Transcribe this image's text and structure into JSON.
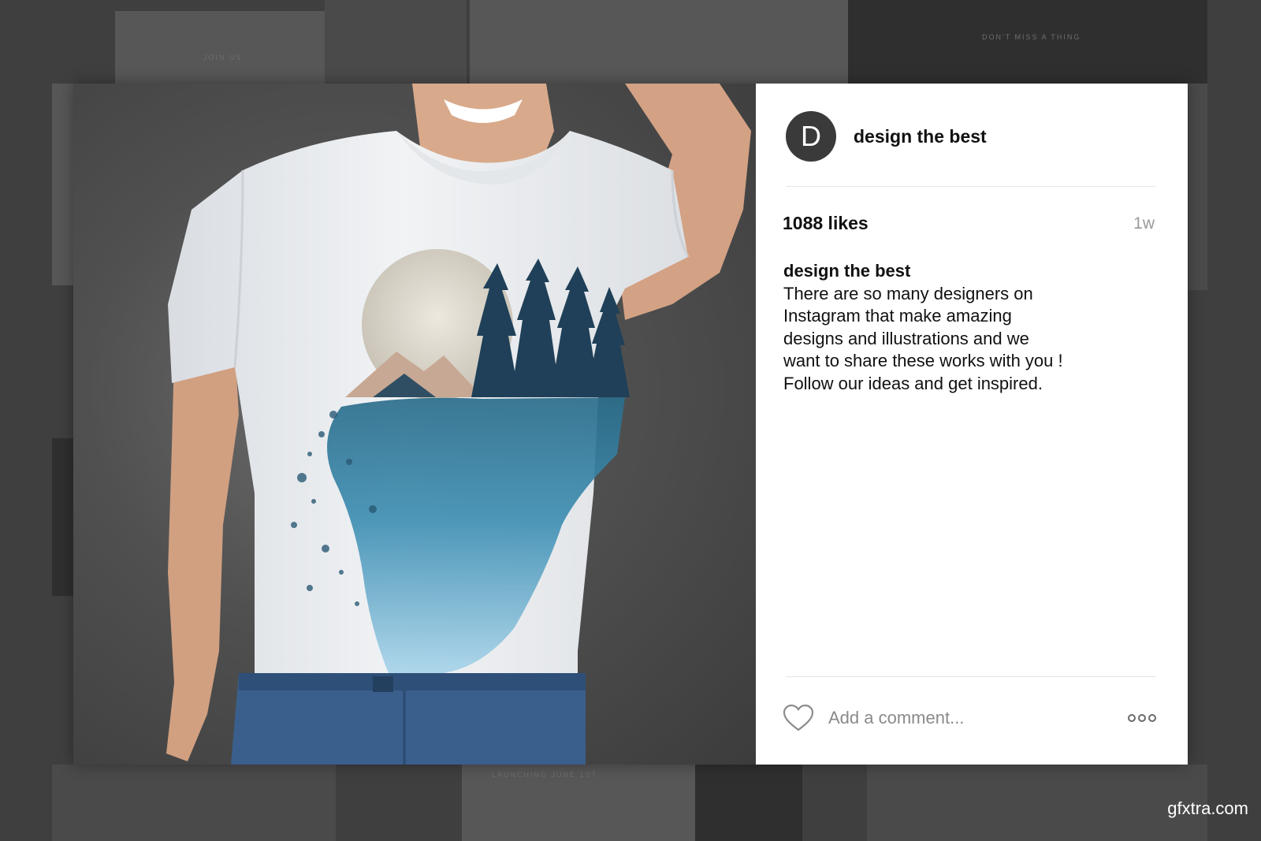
{
  "background": {
    "texts": [
      "JOIN US",
      "DON'T MISS A THING",
      "LAUNCHING JUNE 1ST"
    ]
  },
  "post": {
    "avatar_letter": "D",
    "username": "design the best",
    "likes": "1088 likes",
    "time_ago": "1w",
    "caption": {
      "user": "design the best",
      "text": "There are so many designers on Instagram that make amazing designs and illustrations and we want to share these works with you ! Follow our ideas and get inspired."
    },
    "comment": {
      "placeholder": "Add a comment..."
    },
    "icons": {
      "like": "heart-icon",
      "more": "more-options-icon"
    }
  },
  "watermark": "gfxtra.com",
  "colors": {
    "avatar_bg": "#3a3a3a",
    "panel_bg": "#ffffff",
    "overlay_bg": "#3f3f3f",
    "secondary_text": "#9a9a9a"
  }
}
